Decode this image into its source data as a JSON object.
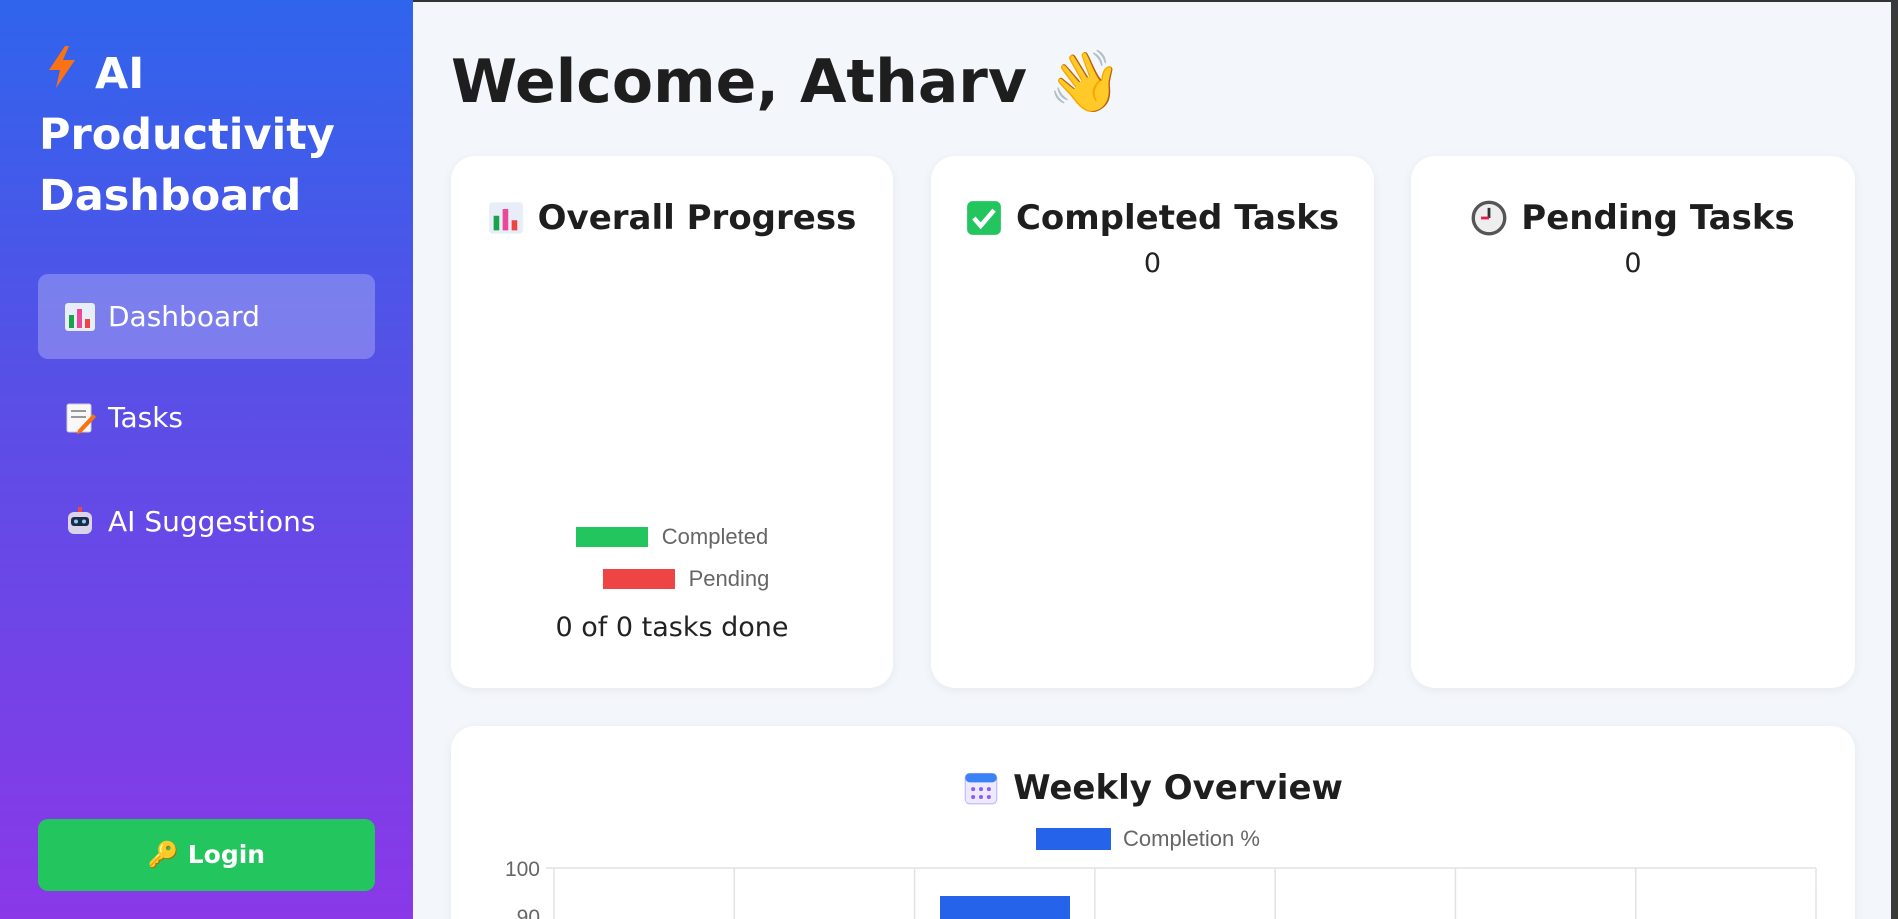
{
  "sidebar": {
    "brand_icon": "lightning-bolt-icon",
    "brand_title": "AI Productivity Dashboard",
    "items": [
      {
        "label": "Dashboard",
        "icon": "bar-chart-icon",
        "active": true
      },
      {
        "label": "Tasks",
        "icon": "memo-icon",
        "active": false
      },
      {
        "label": "AI Suggestions",
        "icon": "robot-icon",
        "active": false
      }
    ],
    "login_label": "🔑 Login"
  },
  "main": {
    "welcome": "Welcome, Atharv 👋"
  },
  "cards": {
    "progress": {
      "title": "Overall Progress",
      "icon": "bar-chart-icon",
      "legend": [
        {
          "label": "Completed",
          "color": "#22c55e"
        },
        {
          "label": "Pending",
          "color": "#ef4444"
        }
      ],
      "summary": "0 of 0 tasks done"
    },
    "completed": {
      "title": "Completed Tasks",
      "icon": "check-mark-icon",
      "value": "0"
    },
    "pending": {
      "title": "Pending Tasks",
      "icon": "clock-icon",
      "value": "0"
    }
  },
  "weekly": {
    "title": "Weekly Overview",
    "icon": "calendar-icon"
  },
  "chart_data": {
    "type": "bar",
    "title": "Weekly Overview",
    "series": [
      {
        "name": "Completion %",
        "color": "#2563eb"
      }
    ],
    "y_ticks": [
      "100",
      "90"
    ],
    "ylim": [
      0,
      100
    ],
    "grid": true,
    "legend": "top"
  },
  "colors": {
    "accent": "#2563eb",
    "success": "#22c55e",
    "danger": "#ef4444"
  }
}
